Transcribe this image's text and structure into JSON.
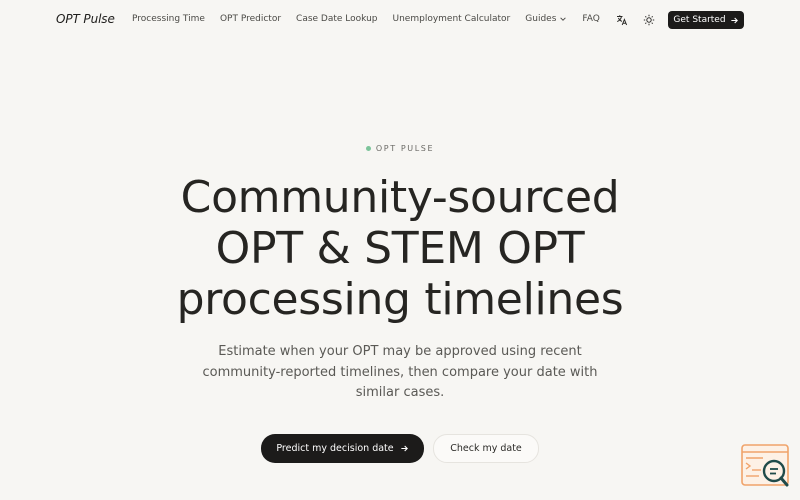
{
  "nav": {
    "logo": "OPT Pulse",
    "links": [
      {
        "label": "Processing Time"
      },
      {
        "label": "OPT Predictor"
      },
      {
        "label": "Case Date Lookup"
      },
      {
        "label": "Unemployment Calculator"
      },
      {
        "label": "Guides"
      },
      {
        "label": "FAQ"
      }
    ],
    "cta_label": "Get Started",
    "icons": [
      "translate-icon",
      "sun-icon",
      "arrow-right-icon",
      "chevron-down-icon"
    ]
  },
  "hero": {
    "eyebrow": "OPT PULSE",
    "headline_lines": [
      "Community-sourced",
      "OPT & STEM OPT",
      "processing timelines"
    ],
    "subtitle": "Estimate when your OPT may be approved using recent community-reported timelines, then compare your date with similar cases.",
    "primary_button": "Predict my decision date",
    "secondary_button": "Check my date"
  },
  "colors": {
    "background": "#f7f6f3",
    "dark": "#1c1b1a",
    "accent_dot": "#7cc49a",
    "widget": "#f0a36a"
  }
}
